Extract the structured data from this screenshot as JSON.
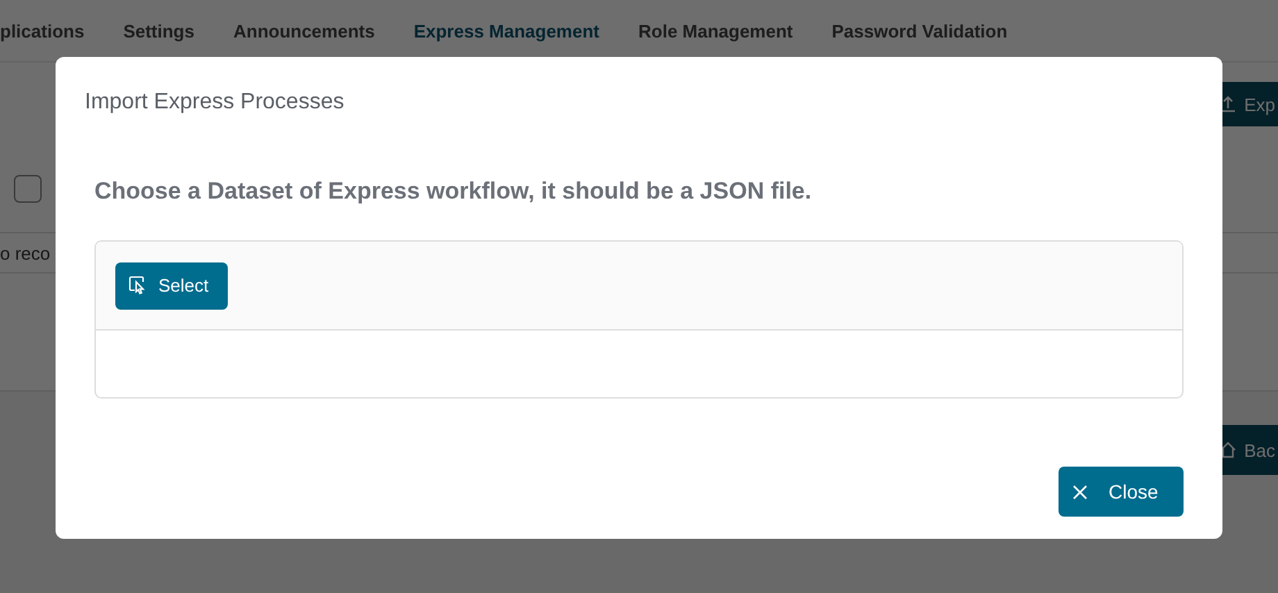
{
  "tabs": [
    {
      "label": "plications",
      "selected": false
    },
    {
      "label": "Settings",
      "selected": false
    },
    {
      "label": "Announcements",
      "selected": false
    },
    {
      "label": "Express Management",
      "selected": true
    },
    {
      "label": "Role Management",
      "selected": false
    },
    {
      "label": "Password Validation",
      "selected": false
    }
  ],
  "toolbar": {
    "export_button": "Exp"
  },
  "table": {
    "header_checkbox": {
      "checked": false
    },
    "empty_message": "o reco"
  },
  "footer": {
    "back_button": "Bac"
  },
  "dialog": {
    "title": "Import Express Processes",
    "instruction": "Choose a Dataset of Express workflow, it should be a JSON file.",
    "select_button": "Select",
    "close_button": "Close"
  }
}
